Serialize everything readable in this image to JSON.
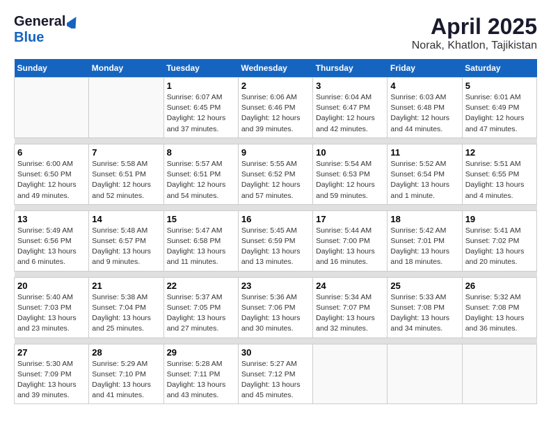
{
  "logo": {
    "line1": "General",
    "line2": "Blue"
  },
  "title": "April 2025",
  "subtitle": "Norak, Khatlon, Tajikistan",
  "days_of_week": [
    "Sunday",
    "Monday",
    "Tuesday",
    "Wednesday",
    "Thursday",
    "Friday",
    "Saturday"
  ],
  "weeks": [
    [
      {
        "day": "",
        "info": ""
      },
      {
        "day": "",
        "info": ""
      },
      {
        "day": "1",
        "sunrise": "6:07 AM",
        "sunset": "6:45 PM",
        "daylight": "12 hours and 37 minutes."
      },
      {
        "day": "2",
        "sunrise": "6:06 AM",
        "sunset": "6:46 PM",
        "daylight": "12 hours and 39 minutes."
      },
      {
        "day": "3",
        "sunrise": "6:04 AM",
        "sunset": "6:47 PM",
        "daylight": "12 hours and 42 minutes."
      },
      {
        "day": "4",
        "sunrise": "6:03 AM",
        "sunset": "6:48 PM",
        "daylight": "12 hours and 44 minutes."
      },
      {
        "day": "5",
        "sunrise": "6:01 AM",
        "sunset": "6:49 PM",
        "daylight": "12 hours and 47 minutes."
      }
    ],
    [
      {
        "day": "6",
        "sunrise": "6:00 AM",
        "sunset": "6:50 PM",
        "daylight": "12 hours and 49 minutes."
      },
      {
        "day": "7",
        "sunrise": "5:58 AM",
        "sunset": "6:51 PM",
        "daylight": "12 hours and 52 minutes."
      },
      {
        "day": "8",
        "sunrise": "5:57 AM",
        "sunset": "6:51 PM",
        "daylight": "12 hours and 54 minutes."
      },
      {
        "day": "9",
        "sunrise": "5:55 AM",
        "sunset": "6:52 PM",
        "daylight": "12 hours and 57 minutes."
      },
      {
        "day": "10",
        "sunrise": "5:54 AM",
        "sunset": "6:53 PM",
        "daylight": "12 hours and 59 minutes."
      },
      {
        "day": "11",
        "sunrise": "5:52 AM",
        "sunset": "6:54 PM",
        "daylight": "13 hours and 1 minute."
      },
      {
        "day": "12",
        "sunrise": "5:51 AM",
        "sunset": "6:55 PM",
        "daylight": "13 hours and 4 minutes."
      }
    ],
    [
      {
        "day": "13",
        "sunrise": "5:49 AM",
        "sunset": "6:56 PM",
        "daylight": "13 hours and 6 minutes."
      },
      {
        "day": "14",
        "sunrise": "5:48 AM",
        "sunset": "6:57 PM",
        "daylight": "13 hours and 9 minutes."
      },
      {
        "day": "15",
        "sunrise": "5:47 AM",
        "sunset": "6:58 PM",
        "daylight": "13 hours and 11 minutes."
      },
      {
        "day": "16",
        "sunrise": "5:45 AM",
        "sunset": "6:59 PM",
        "daylight": "13 hours and 13 minutes."
      },
      {
        "day": "17",
        "sunrise": "5:44 AM",
        "sunset": "7:00 PM",
        "daylight": "13 hours and 16 minutes."
      },
      {
        "day": "18",
        "sunrise": "5:42 AM",
        "sunset": "7:01 PM",
        "daylight": "13 hours and 18 minutes."
      },
      {
        "day": "19",
        "sunrise": "5:41 AM",
        "sunset": "7:02 PM",
        "daylight": "13 hours and 20 minutes."
      }
    ],
    [
      {
        "day": "20",
        "sunrise": "5:40 AM",
        "sunset": "7:03 PM",
        "daylight": "13 hours and 23 minutes."
      },
      {
        "day": "21",
        "sunrise": "5:38 AM",
        "sunset": "7:04 PM",
        "daylight": "13 hours and 25 minutes."
      },
      {
        "day": "22",
        "sunrise": "5:37 AM",
        "sunset": "7:05 PM",
        "daylight": "13 hours and 27 minutes."
      },
      {
        "day": "23",
        "sunrise": "5:36 AM",
        "sunset": "7:06 PM",
        "daylight": "13 hours and 30 minutes."
      },
      {
        "day": "24",
        "sunrise": "5:34 AM",
        "sunset": "7:07 PM",
        "daylight": "13 hours and 32 minutes."
      },
      {
        "day": "25",
        "sunrise": "5:33 AM",
        "sunset": "7:08 PM",
        "daylight": "13 hours and 34 minutes."
      },
      {
        "day": "26",
        "sunrise": "5:32 AM",
        "sunset": "7:08 PM",
        "daylight": "13 hours and 36 minutes."
      }
    ],
    [
      {
        "day": "27",
        "sunrise": "5:30 AM",
        "sunset": "7:09 PM",
        "daylight": "13 hours and 39 minutes."
      },
      {
        "day": "28",
        "sunrise": "5:29 AM",
        "sunset": "7:10 PM",
        "daylight": "13 hours and 41 minutes."
      },
      {
        "day": "29",
        "sunrise": "5:28 AM",
        "sunset": "7:11 PM",
        "daylight": "13 hours and 43 minutes."
      },
      {
        "day": "30",
        "sunrise": "5:27 AM",
        "sunset": "7:12 PM",
        "daylight": "13 hours and 45 minutes."
      },
      {
        "day": "",
        "info": ""
      },
      {
        "day": "",
        "info": ""
      },
      {
        "day": "",
        "info": ""
      }
    ]
  ]
}
